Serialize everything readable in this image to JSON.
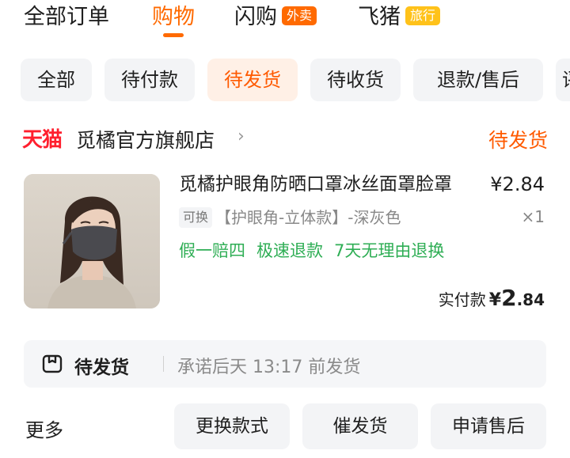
{
  "top_tabs": [
    {
      "label": "全部订单"
    },
    {
      "label": "购物"
    },
    {
      "label": "闪购",
      "badge": "外卖"
    },
    {
      "label": "飞猪",
      "badge": "旅行"
    }
  ],
  "sub_tabs": [
    "全部",
    "待付款",
    "待发货",
    "待收货",
    "退款/售后",
    "评"
  ],
  "shop": {
    "platform": "天猫",
    "name": "觅橘官方旗舰店",
    "status": "待发货"
  },
  "product": {
    "title": "觅橘护眼角防晒口罩冰丝面罩脸罩",
    "price": "¥2.84",
    "sku_tag": "可换",
    "sku": "【护眼角-立体款】-深灰色",
    "quantity": "×1",
    "services": [
      "假一赔四",
      "极速退款",
      "7天无理由退换"
    ],
    "paid_label": "实付款",
    "paid_yen": "¥",
    "paid_int": "2",
    "paid_dec": ".84"
  },
  "shipping": {
    "status": "待发货",
    "promise": "承诺后天 13:17 前发货"
  },
  "actions": {
    "more": "更多",
    "buttons": [
      "更换款式",
      "催发货",
      "申请售后"
    ]
  },
  "colors": {
    "accent": "#ff6a00",
    "tmall_red": "#ff1f2e",
    "service_green": "#2fae55"
  }
}
